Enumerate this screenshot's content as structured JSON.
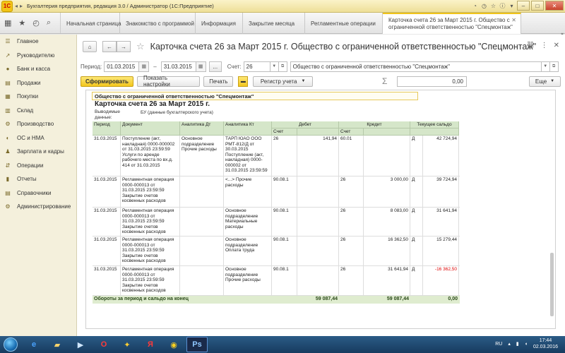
{
  "window": {
    "logo": "1С",
    "title": "Бухгалтерия предприятия, редакция 3.0 / Администратор (1С:Предприятие)"
  },
  "tabs": [
    {
      "label": "Начальная страница"
    },
    {
      "label": "Знакомство с программой"
    },
    {
      "label": "Информация"
    },
    {
      "label": "Закрытие месяца"
    },
    {
      "label": "Регламентные операции"
    },
    {
      "label": "Карточка счета 26 за Март 2015 г. Общество с ограниченной ответственностью \"Спецмонтаж\""
    }
  ],
  "sidebar": {
    "items": [
      {
        "label": "Главное",
        "icon": "list-icon",
        "glyph": "☰"
      },
      {
        "label": "Руководителю",
        "icon": "chart-line-icon",
        "glyph": "↗"
      },
      {
        "label": "Банк и касса",
        "icon": "coins-icon",
        "glyph": "●"
      },
      {
        "label": "Продажи",
        "icon": "sales-icon",
        "glyph": "▤"
      },
      {
        "label": "Покупки",
        "icon": "cart-icon",
        "glyph": "▦"
      },
      {
        "label": "Склад",
        "icon": "warehouse-icon",
        "glyph": "▥"
      },
      {
        "label": "Производство",
        "icon": "factory-icon",
        "glyph": "⚙"
      },
      {
        "label": "ОС и НМА",
        "icon": "assets-icon",
        "glyph": "◐"
      },
      {
        "label": "Зарплата и кадры",
        "icon": "people-icon",
        "glyph": "♟"
      },
      {
        "label": "Операции",
        "icon": "operations-icon",
        "glyph": "⇵"
      },
      {
        "label": "Отчеты",
        "icon": "reports-icon",
        "glyph": "▮"
      },
      {
        "label": "Справочники",
        "icon": "books-icon",
        "glyph": "▤"
      },
      {
        "label": "Администрирование",
        "icon": "gear-icon",
        "glyph": "⚙"
      }
    ]
  },
  "main": {
    "title": "Карточка счета 26 за Март 2015 г. Общество с ограниченной ответственностью \"Спецмонтаж\"",
    "filters": {
      "period_label": "Период:",
      "date_from": "01.03.2015",
      "dash": "–",
      "date_to": "31.03.2015",
      "dots": "...",
      "account_label": "Счет:",
      "account": "26",
      "organization": "Общество с ограниченной ответственностью \"Спецмонтаж\""
    },
    "toolbar": {
      "generate": "Сформировать",
      "settings": "Показать настройки",
      "print": "Печать",
      "register": "Регистр учета",
      "sum": "0,00",
      "more": "Еще"
    },
    "report": {
      "org": "Общество с ограниченной ответственностью \"Спецмонтаж\"",
      "title": "Карточка счета 26 за Март 2015 г.",
      "note_label": "Выводимые данные:",
      "note_value": "БУ (данные бухгалтерского учета)",
      "headers": {
        "period": "Период",
        "document": "Документ",
        "analytics_dt": "Аналитика Дт",
        "analytics_kt": "Аналитика Кт",
        "debit": "Дебет",
        "credit": "Кредит",
        "balance": "Текущее сальдо",
        "account_dt": "Счет",
        "account_kt": "Счет"
      },
      "rows": [
        {
          "period": "31.03.2015",
          "document": "Поступление (акт, накладная) 0000-000002 от 31.03.2015 23:59:59 Услуги по аренде рабочего места по вх.д. 414 от 31.03.2015",
          "dt": "Основное подразделение Прочие расходы",
          "kt": "ТАРП ЮАО ООО РМТ-812/Д от 30.03.2015 Поступление (акт, накладная) 0000-000002 от 31.03.2015 23:59:59",
          "acc_dt": "26",
          "debit": "141,94",
          "acc_kt": "60.01",
          "credit": "",
          "dk": "Д",
          "balance": "42 724,94",
          "red": false
        },
        {
          "period": "31.03.2015",
          "document": "Регламентная операция 0000-000013 от 31.03.2015 23:59:59 Закрытие счетов косвенных расходов",
          "dt": "",
          "kt": "<...> Прочие расходы",
          "acc_dt": "90.08.1",
          "debit": "",
          "acc_kt": "26",
          "credit": "3 000,00",
          "dk": "Д",
          "balance": "39 724,94",
          "red": false
        },
        {
          "period": "31.03.2015",
          "document": "Регламентная операция 0000-000013 от 31.03.2015 23:59:59 Закрытие счетов косвенных расходов",
          "dt": "",
          "kt": "Основное подразделение Материальные расходы",
          "acc_dt": "90.08.1",
          "debit": "",
          "acc_kt": "26",
          "credit": "8 083,00",
          "dk": "Д",
          "balance": "31 641,94",
          "red": false
        },
        {
          "period": "31.03.2015",
          "document": "Регламентная операция 0000-000013 от 31.03.2015 23:59:59 Закрытие счетов косвенных расходов",
          "dt": "",
          "kt": "Основное подразделение Оплата труда",
          "acc_dt": "90.08.1",
          "debit": "",
          "acc_kt": "26",
          "credit": "16 362,50",
          "dk": "Д",
          "balance": "15 279,44",
          "red": false
        },
        {
          "period": "31.03.2015",
          "document": "Регламентная операция 0000-000013 от 31.03.2015 23:59:59 Закрытие счетов косвенных расходов",
          "dt": "",
          "kt": "Основное подразделение Прочие расходы",
          "acc_dt": "90.08.1",
          "debit": "",
          "acc_kt": "26",
          "credit": "31 641,94",
          "dk": "Д",
          "balance": "-16 362,50",
          "red": true
        }
      ],
      "footer": {
        "label": "Обороты за период и сальдо на конец",
        "debit": "59 087,44",
        "credit": "59 087,44",
        "balance": "0,00"
      }
    }
  },
  "taskbar": {
    "lang": "RU",
    "time": "17:44",
    "date": "02.03.2016"
  },
  "colors": {
    "accent": "#f3c61c",
    "table_header": "#d5e6c9",
    "negative": "#dd0000"
  }
}
